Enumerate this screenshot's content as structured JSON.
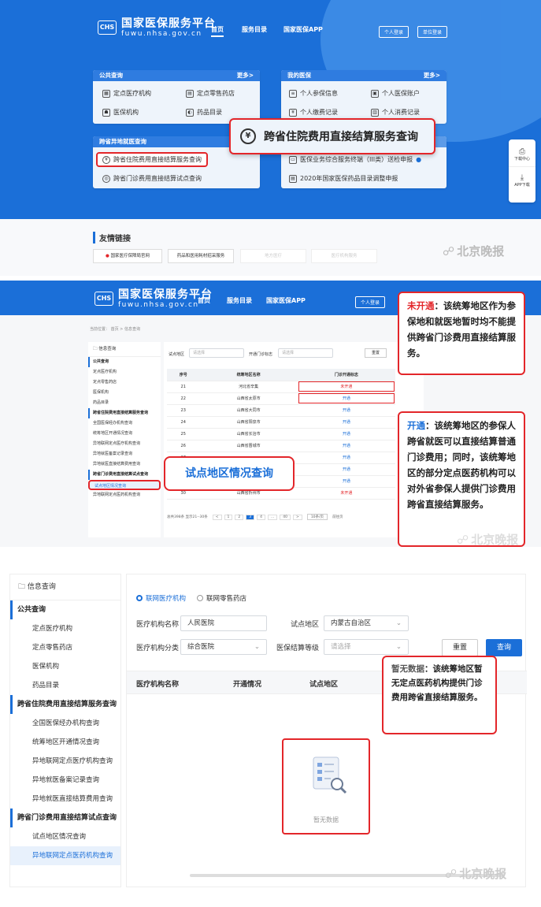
{
  "s1": {
    "logo": {
      "mark": "CHS",
      "title": "国家医保服务平台",
      "domain": "fuwu.nhsa.gov.cn"
    },
    "nav": [
      "首页",
      "服务目录",
      "国家医保APP"
    ],
    "top_buttons": [
      "个人登录",
      "单位登录"
    ],
    "public_card": {
      "title": "公共查询",
      "more": "更多>",
      "items": [
        "定点医疗机构",
        "定点零售药店",
        "医保机构",
        "药品目录"
      ]
    },
    "my_card": {
      "title": "我的医保",
      "more": "更多>",
      "items": [
        "个人参保信息",
        "个人医保账户",
        "个人缴费记录",
        "个人消费记录"
      ]
    },
    "remote_card": {
      "title": "跨省异地就医查询",
      "items": [
        "跨省住院费用直接结算服务查询",
        "跨省门诊费用直接结算试点查询"
      ]
    },
    "other_items": [
      "医保业务综合服务终端（III类）送检申报",
      "2020年国家医保药品目录调整申报"
    ],
    "popup": "跨省住院费用直接结算服务查询",
    "right_sidebar": [
      "下载中心",
      "APP下载"
    ],
    "links_title": "友情链接",
    "links": [
      "国家医疗保障局官网",
      "药品和医用耗材招采服务",
      "地方医疗",
      "医疗机构服务"
    ],
    "watermark": "北京晚报"
  },
  "s2": {
    "logo": {
      "mark": "CHS",
      "title": "国家医保服务平台",
      "domain": "fuwu.nhsa.gov.cn"
    },
    "nav": [
      "首页",
      "服务目录",
      "国家医保APP"
    ],
    "top_buttons": [
      "个人登录"
    ],
    "breadcrumb": "当前位置：  首页  >  信息查询",
    "sidebar": {
      "title": "信息查询",
      "sections": [
        {
          "head": "公共查询",
          "items": [
            "定点医疗机构",
            "定点零售药店",
            "医保机构",
            "药品目录"
          ]
        },
        {
          "head": "跨省住院费用直接结算服务查询",
          "items": [
            "全国医保经办机构查询",
            "统筹地区开通情况查询",
            "异地联网定点医疗机构查询",
            "异地就医备案记录查询",
            "异地就医直接结算费用查询"
          ]
        },
        {
          "head": "跨省门诊费用直接结算试点查询",
          "items": [
            "试点地区情况查询",
            "异地联网定点医药机构查询"
          ]
        }
      ]
    },
    "filters": {
      "area_label": "试点地区",
      "area_ph": "请选择",
      "status_label": "开通门诊标志",
      "status_ph": "请选择",
      "reset": "重置"
    },
    "table": {
      "headers": [
        "序号",
        "统筹地区名称",
        "门诊开通标志"
      ],
      "rows": [
        [
          "21",
          "河北省辛集",
          "未开通"
        ],
        [
          "22",
          "山西省太原市",
          "开通"
        ],
        [
          "23",
          "山西省大同市",
          "开通"
        ],
        [
          "24",
          "山西省阳泉市",
          "开通"
        ],
        [
          "25",
          "山西省长治市",
          "开通"
        ],
        [
          "26",
          "山西省晋城市",
          "开通"
        ],
        [
          "27",
          "",
          "开通"
        ],
        [
          "28",
          "",
          "开通"
        ],
        [
          "29",
          "",
          "开通"
        ],
        [
          "30",
          "山西省忻州市",
          "未开通"
        ]
      ]
    },
    "pagination": {
      "total": "总共398条 显示21--30条",
      "pages": [
        "<",
        "1",
        "2",
        "3",
        "4",
        "...",
        "40",
        ">"
      ],
      "size": "10条/页",
      "jump": "前往页"
    },
    "label_pilot": "试点地区情况查询",
    "callout_closed": {
      "kw": "未开通",
      "text": "：该统筹地区作为参保地和就医地暂时均不能提供跨省门诊费用直接结算服务。"
    },
    "callout_open": {
      "kw": "开通",
      "text": "：该统筹地区的参保人跨省就医可以直接结算普通门诊费用；同时，该统筹地区的部分定点医药机构可以对外省参保人提供门诊费用跨省直接结算服务。"
    },
    "watermark": "北京晚报"
  },
  "s3": {
    "sidebar": {
      "title": "信息查询",
      "sections": [
        {
          "head": "公共查询",
          "items": [
            "定点医疗机构",
            "定点零售药店",
            "医保机构",
            "药品目录"
          ]
        },
        {
          "head": "跨省住院费用直接结算服务查询",
          "items": [
            "全国医保经办机构查询",
            "统筹地区开通情况查询",
            "异地联网定点医疗机构查询",
            "异地就医备案记录查询",
            "异地就医直接结算费用查询"
          ]
        },
        {
          "head": "跨省门诊费用直接结算试点查询",
          "items": [
            "试点地区情况查询",
            "异地联网定点医药机构查询"
          ]
        }
      ]
    },
    "radio": {
      "opt1": "联网医疗机构",
      "opt2": "联网零售药店"
    },
    "form": {
      "name_label": "医疗机构名称",
      "name_value": "人民医院",
      "area_label": "试点地区",
      "area_value": "内蒙古自治区",
      "cat_label": "医疗机构分类",
      "cat_value": "综合医院",
      "level_label": "医保结算等级",
      "level_ph": "请选择",
      "reset": "重置",
      "query": "查询"
    },
    "table_headers": [
      "医疗机构名称",
      "开通情况",
      "试点地区"
    ],
    "empty": "暂无数据",
    "callout": {
      "kw": "暂无数据",
      "text": "：该统筹地区暂无定点医药机构提供门诊费用跨省直接结算服务。"
    },
    "watermark": "北京晚报"
  },
  "colors": {
    "brand": "#1b6fd8",
    "highlight": "#e3262a",
    "open": "#1b6fd8",
    "closed": "#e3262a"
  }
}
